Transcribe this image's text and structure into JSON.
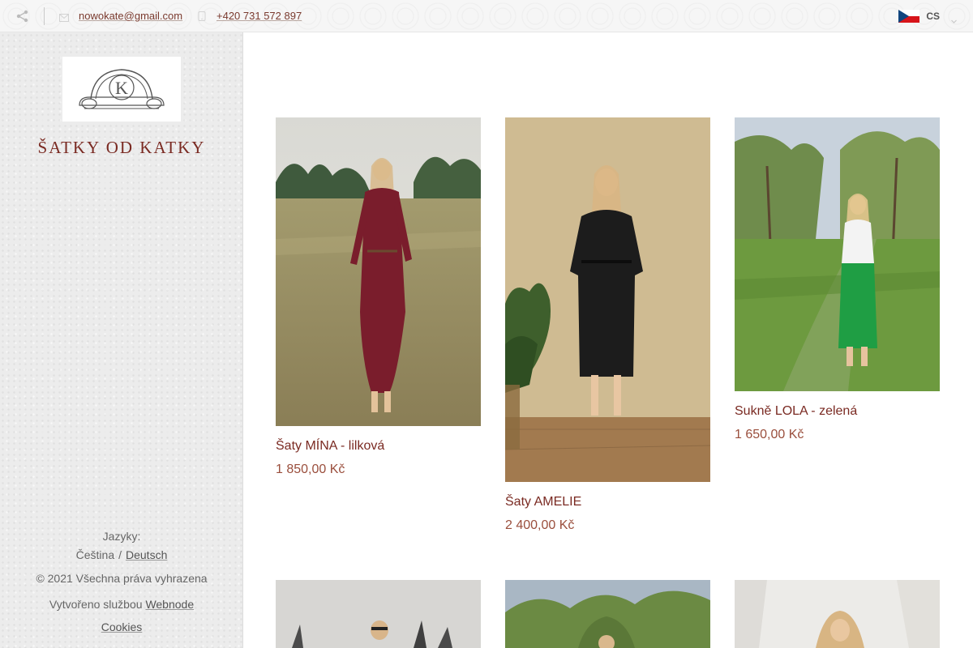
{
  "topbar": {
    "email": "nowokate@gmail.com",
    "phone": "+420 731 572 897",
    "language_code": "CS"
  },
  "sidebar": {
    "site_title": "ŠATKY OD KATKY",
    "languages_label": "Jazyky:",
    "languages": [
      "Čeština",
      "Deutsch"
    ],
    "copyright": "© 2021 Všechna práva vyhrazena",
    "created_by_prefix": "Vytvořeno službou",
    "created_by_link": "Webnode",
    "cookies": "Cookies"
  },
  "products": [
    {
      "name": "Šaty MÍNA - lilková",
      "price": "1 850,00 Kč"
    },
    {
      "name": "Šaty AMELIE",
      "price": "2 400,00 Kč"
    },
    {
      "name": "Sukně LOLA - zelená",
      "price": "1 650,00 Kč"
    }
  ],
  "icons": {
    "share": "share-icon",
    "email": "envelope-icon",
    "phone": "phone-icon",
    "language_flag": "czech-flag-icon",
    "dropdown": "chevron-down-icon"
  },
  "colors": {
    "accent": "#7a2a22",
    "price": "#9a4e3c",
    "link": "#7a3a2e"
  }
}
